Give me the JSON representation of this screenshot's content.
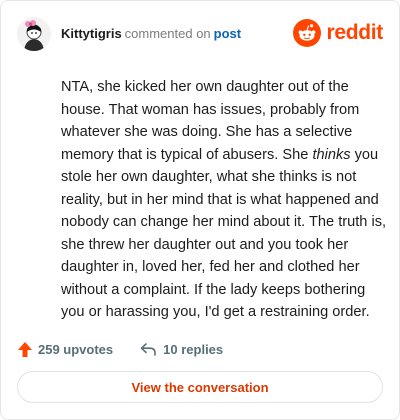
{
  "comment": {
    "username": "Kittytigris",
    "action_text": "commented on",
    "post_link_label": "post",
    "body_before_em": "NTA, she kicked her own daughter out of the house. That woman has issues, probably from whatever she was doing. She has a selective memory that is typical of abusers. She ",
    "body_em": "thinks",
    "body_after_em": " you stole her own daughter, what she thinks is not reality, but in her mind that is what happened and nobody can change her mind about it. The truth is, she threw her daughter out and you took her daughter in, loved her, fed her and clothed her without a complaint. If the lady keeps bothering you or harassing you, I'd get a restraining order."
  },
  "brand": {
    "wordmark": "reddit",
    "color": "#ff4500"
  },
  "footer": {
    "upvotes_label": "259 upvotes",
    "replies_label": "10 replies",
    "upvote_icon": "arrow-up-icon",
    "reply_icon": "reply-arrow-icon"
  },
  "cta": {
    "label": "View the conversation",
    "color": "#d93a00"
  },
  "colors": {
    "link": "#0a64b4",
    "muted": "#7c7c7c",
    "icon_gray": "#576f76"
  }
}
